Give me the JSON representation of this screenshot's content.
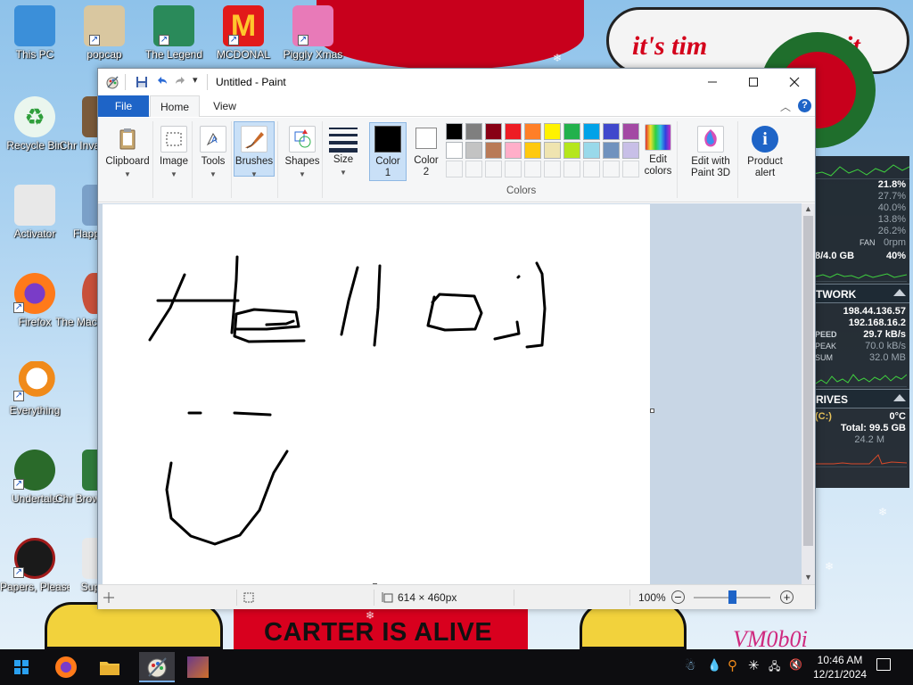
{
  "desktop": {
    "icons": [
      {
        "label": "This PC",
        "color": "#3b8fd9"
      },
      {
        "label": "popcap",
        "color": "#e0b030"
      },
      {
        "label": "The Legend",
        "color": "#2a8a5a"
      },
      {
        "label": "MCDONAL",
        "color": "#e21a1a"
      },
      {
        "label": "Piggly Xmas",
        "color": "#e87ab8"
      },
      {
        "label": "Recycle Bin",
        "color": "#2f9e3b"
      },
      {
        "label": "Chr Inva",
        "color": "#7a5a3a"
      },
      {
        "label": "Activator",
        "color": "#e8e8e8"
      },
      {
        "label": "Flapp",
        "color": "#7aa0c8"
      },
      {
        "label": "Firefox",
        "color": "#ff7a1a"
      },
      {
        "label": "The Mach",
        "color": "#c8503a"
      },
      {
        "label": "Everything",
        "color": "#f08a1a"
      },
      {
        "label": "Undertale",
        "color": "#2a6a2a"
      },
      {
        "label": "Chr Brow",
        "color": "#2f7a3b"
      },
      {
        "label": "Papers, Please",
        "color": "#a01a1a"
      },
      {
        "label": "Sup",
        "color": "#e8e8e8"
      }
    ]
  },
  "wallpaper": {
    "banner_text": "it's tim",
    "banner_text_tail": "it",
    "carter_text": "CARTER IS ALIVE",
    "vm_text": "VM0b0i"
  },
  "monitor": {
    "cpu_rows": [
      {
        "label": "",
        "value": "21.8%"
      },
      {
        "label": "",
        "value": "27.7%"
      },
      {
        "label": "",
        "value": "40.0%"
      },
      {
        "label": "",
        "value": "13.8%"
      },
      {
        "label": "",
        "value": "26.2%"
      },
      {
        "label": "FAN",
        "value": "0rpm"
      }
    ],
    "ram": {
      "label": "8/4.0 GB",
      "value": "40%"
    },
    "network_title": "TWORK",
    "network_rows": [
      {
        "label": "",
        "value": "198.44.136.57"
      },
      {
        "label": "",
        "value": "192.168.16.2"
      },
      {
        "label": "PEED",
        "value": "29.7 kB/s"
      },
      {
        "label": "PEAK",
        "value": "70.0 kB/s"
      },
      {
        "label": "SUM",
        "value": "32.0 MB"
      }
    ],
    "drives_title": "RIVES",
    "drive_rows": [
      {
        "label": "(C:)",
        "value": "0°C"
      },
      {
        "label": "",
        "value": "Total: 99.5 GB"
      },
      {
        "label": "",
        "value": "24.2 M"
      }
    ]
  },
  "paint": {
    "title": "Untitled - Paint",
    "tabs": {
      "file": "File",
      "home": "Home",
      "view": "View"
    },
    "ribbon": {
      "clipboard": "Clipboard",
      "image": "Image",
      "tools": "Tools",
      "brushes": "Brushes",
      "shapes": "Shapes",
      "size": "Size",
      "color1_line1": "Color",
      "color1_line2": "1",
      "color2_line1": "Color",
      "color2_line2": "2",
      "colors_group": "Colors",
      "edit_colors_line1": "Edit",
      "edit_colors_line2": "colors",
      "edit_3d_line1": "Edit with",
      "edit_3d_line2": "Paint 3D",
      "product_alert_line1": "Product",
      "product_alert_line2": "alert"
    },
    "palette_row1": [
      "#000000",
      "#7f7f7f",
      "#880015",
      "#ed1c24",
      "#ff7f27",
      "#fff200",
      "#22b14c",
      "#00a2e8",
      "#3f48cc",
      "#a349a4"
    ],
    "palette_row2": [
      "#ffffff",
      "#c3c3c3",
      "#b97a57",
      "#ffaec9",
      "#ffc90e",
      "#efe4b0",
      "#b5e61d",
      "#99d9ea",
      "#7092be",
      "#c8bfe7"
    ],
    "palette_row3": [
      "#f5f6f7",
      "#f5f6f7",
      "#f5f6f7",
      "#f5f6f7",
      "#f5f6f7",
      "#f5f6f7",
      "#f5f6f7",
      "#f5f6f7",
      "#f5f6f7",
      "#f5f6f7"
    ],
    "status": {
      "size": "614 × 460px",
      "zoom": "100%",
      "zoom_level": 0.5
    }
  },
  "taskbar": {
    "time": "10:46 AM",
    "date": "12/21/2024"
  }
}
